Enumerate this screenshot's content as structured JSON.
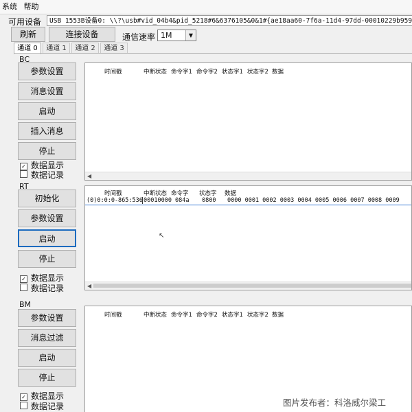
{
  "menu": {
    "items": [
      "系统",
      "帮助"
    ]
  },
  "device": {
    "label": "可用设备",
    "value": "USB 1553B设备0: \\\\?\\usb#vid_04b4&pid_5218#6&6376105&0&1#{ae18aa60-7f6a-11d4-97dd-00010229b959}"
  },
  "toolbar": {
    "refresh": "刷新",
    "connect": "连接设备",
    "rate_label": "通信速率",
    "rate_value": "1M"
  },
  "tabs": [
    "通道 0",
    "通道 1",
    "通道 2",
    "通道 3"
  ],
  "bc": {
    "label": "BC",
    "buttons": [
      "参数设置",
      "消息设置",
      "启动",
      "插入消息",
      "停止"
    ],
    "display_check": "数据显示",
    "record_check": "数据记录",
    "columns": [
      "时间戳",
      "中断状态",
      "命令字1",
      "命令字2",
      "状态字1",
      "状态字2",
      "数据"
    ]
  },
  "rt": {
    "label": "RT",
    "buttons": [
      "初始化",
      "参数设置",
      "启动",
      "停止"
    ],
    "display_check": "数据显示",
    "record_check": "数据记录",
    "columns": [
      "时间戳",
      "中断状态",
      "命令字",
      "状态字",
      "数据"
    ],
    "rows": [
      {
        "ts": "(0)0:0:0-865:536",
        "irq": "00010000",
        "cmd": "084a",
        "status": "0800",
        "data": "0000 0001 0002 0003 0004 0005 0006 0007 0008 0009"
      }
    ]
  },
  "bm": {
    "label": "BM",
    "buttons": [
      "参数设置",
      "消息过滤",
      "启动",
      "停止"
    ],
    "display_check": "数据显示",
    "record_check": "数据记录",
    "columns": [
      "时间戳",
      "中断状态",
      "命令字1",
      "命令字2",
      "状态字1",
      "状态字2",
      "数据"
    ]
  },
  "checks": {
    "display_checked": true,
    "record_checked": false
  },
  "watermark": "图片发布者：科洛威尔梁工"
}
